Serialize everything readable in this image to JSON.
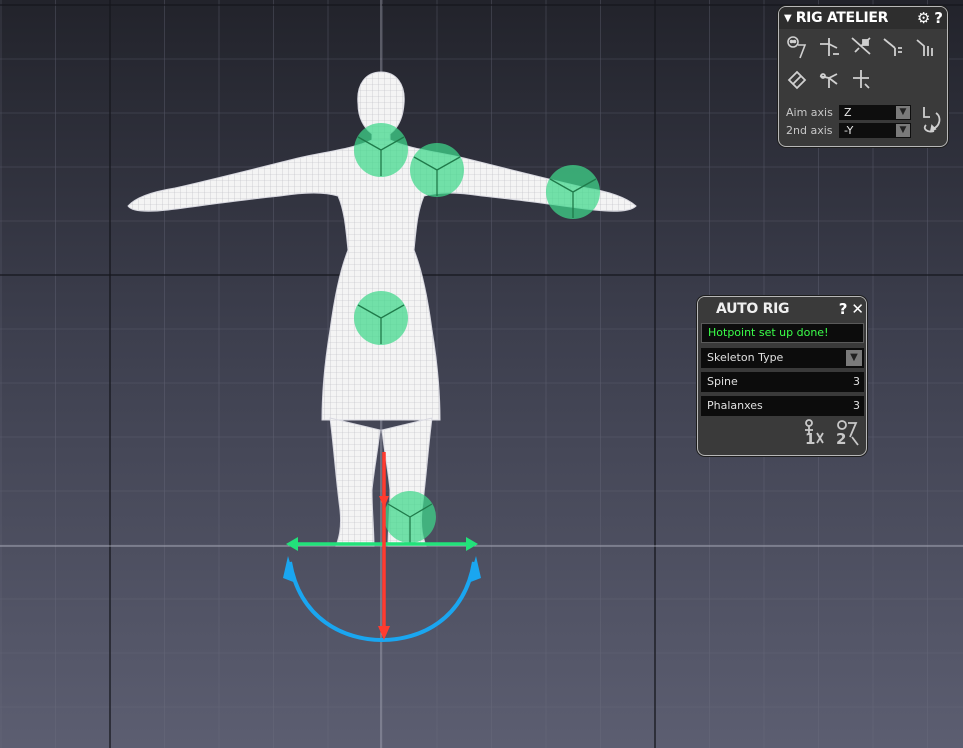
{
  "rig_atelier": {
    "collapse_arrow": "▼",
    "title": "RIG ATELIER",
    "settings_glyph": "⚙",
    "help_glyph": "?",
    "tools": [
      "skull-tool-icon",
      "bone-chain-icon",
      "bone-mirror-icon",
      "bone-align-icon",
      "bone-split-icon",
      "bone-orient-icon",
      "bone-connect-icon",
      "bone-add-icon"
    ],
    "aim_axis_label": "Aim axis",
    "aim_axis_value": "Z",
    "second_axis_label": "2nd axis",
    "second_axis_value": "-Y",
    "dropdown_glyph": "▼"
  },
  "auto_rig": {
    "title": "AUTO RIG",
    "help_glyph": "?",
    "close_glyph": "✕",
    "status": "Hotpoint set up done!",
    "skeleton_type_label": "Skeleton Type",
    "spine_label": "Spine",
    "spine_value": "3",
    "phalanxes_label": "Phalanxes",
    "phalanxes_value": "3",
    "dropdown_glyph": "▼",
    "step_buttons": [
      "1",
      "2"
    ]
  },
  "colors": {
    "hotpoint": "#3fd88a",
    "gizmo_x": "#22e27a",
    "gizmo_y": "#ff3b2f",
    "gizmo_rotate": "#1aa6f0",
    "status_text": "#3bff4a"
  }
}
